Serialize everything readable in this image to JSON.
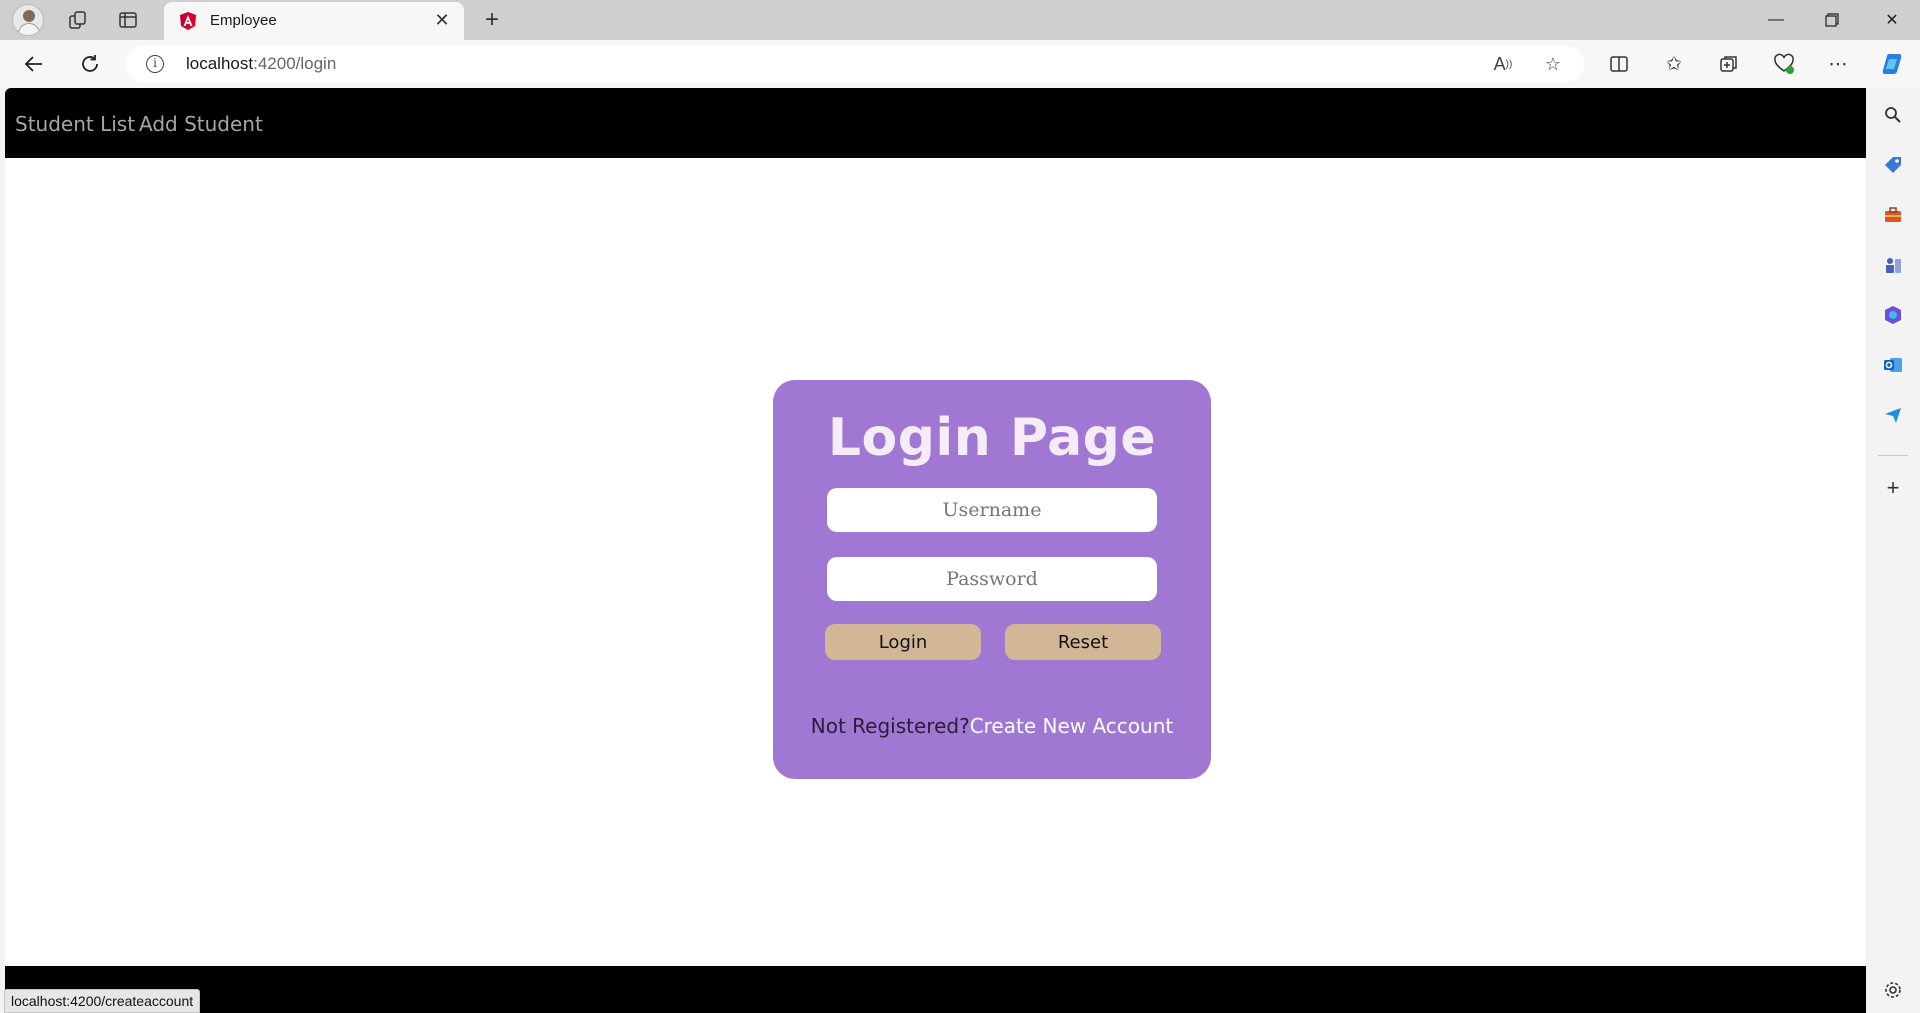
{
  "browser": {
    "tab_title": "Employee",
    "url_host": "localhost",
    "url_rest": ":4200/login",
    "status_url": "localhost:4200/createaccount",
    "icons": {
      "workspaces": "workspaces-icon",
      "tab_actions": "tab-actions-icon",
      "favicon": "angular-favicon-icon",
      "close_tab": "close-icon",
      "new_tab": "plus-icon",
      "minimize": "minimize-icon",
      "restore": "restore-icon",
      "close_window": "close-window-icon",
      "back": "back-arrow-icon",
      "refresh": "refresh-icon",
      "site_info": "info-icon",
      "read_aloud": "read-aloud-icon",
      "favorite": "star-icon",
      "split_screen": "split-screen-icon",
      "favorites": "favorites-icon",
      "collections": "collections-icon",
      "browser_essentials": "heart-pulse-icon",
      "more": "more-icon",
      "copilot": "copilot-icon"
    },
    "sidebar": [
      "search-icon",
      "tag-icon",
      "toolbox-icon",
      "games-icon",
      "office-icon",
      "outlook-icon",
      "send-icon",
      "add-icon",
      "settings-icon"
    ]
  },
  "app": {
    "nav": {
      "student_list": "Student List",
      "add_student": "Add Student"
    },
    "login": {
      "title": "Login Page",
      "username_placeholder": "Username",
      "password_placeholder": "Password",
      "login_label": "Login",
      "reset_label": "Reset",
      "not_registered": "Not Registered?",
      "create_account": "Create New Account"
    }
  },
  "colors": {
    "card": "#a078d4",
    "button": "#d1b795",
    "nav_bg": "#000000",
    "nav_link": "#a6a6a6"
  }
}
